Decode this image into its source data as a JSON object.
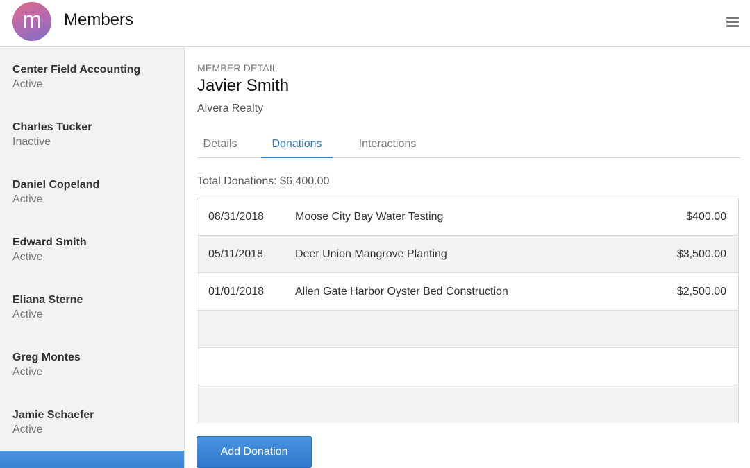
{
  "header": {
    "logo_letter": "m",
    "title": "Members"
  },
  "sidebar": {
    "members": [
      {
        "name": "Center Field Accounting",
        "status": "Active"
      },
      {
        "name": "Charles Tucker",
        "status": "Inactive"
      },
      {
        "name": "Daniel Copeland",
        "status": "Active"
      },
      {
        "name": "Edward Smith",
        "status": "Active"
      },
      {
        "name": "Eliana Sterne",
        "status": "Active"
      },
      {
        "name": "Greg Montes",
        "status": "Active"
      },
      {
        "name": "Jamie Schaefer",
        "status": "Active"
      }
    ]
  },
  "detail": {
    "eyebrow": "MEMBER DETAIL",
    "name": "Javier Smith",
    "company": "Alvera Realty",
    "tabs": [
      {
        "label": "Details",
        "active": false
      },
      {
        "label": "Donations",
        "active": true
      },
      {
        "label": "Interactions",
        "active": false
      }
    ],
    "total_donations": "Total Donations: $6,400.00",
    "donations": [
      {
        "date": "08/31/2018",
        "description": "Moose City Bay Water Testing",
        "amount": "$400.00"
      },
      {
        "date": "05/11/2018",
        "description": "Deer Union Mangrove Planting",
        "amount": "$3,500.00"
      },
      {
        "date": "01/01/2018",
        "description": "Allen Gate Harbor Oyster Bed Construction",
        "amount": "$2,500.00"
      }
    ],
    "add_button": "Add Donation"
  },
  "colors": {
    "accent": "#2f76c5",
    "sidebar_bg": "#f2f2f2",
    "alt_row_bg": "#f2f2f2"
  },
  "icons": {
    "menu": "hamburger-menu-icon",
    "logo": "app-logo"
  }
}
